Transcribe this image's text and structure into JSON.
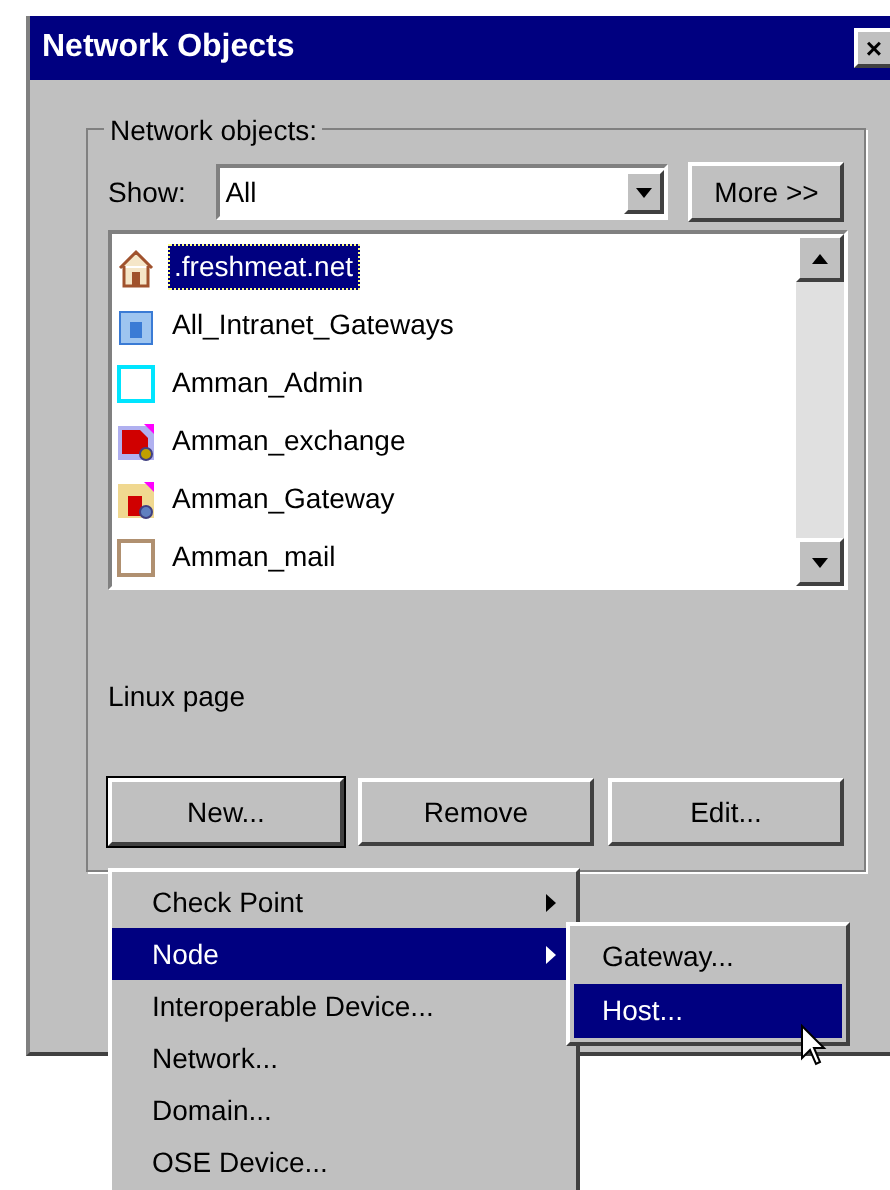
{
  "window": {
    "title": "Network Objects",
    "close": "×"
  },
  "group": {
    "label": "Network objects:"
  },
  "show": {
    "label": "Show:",
    "value": "All",
    "more": "More >>"
  },
  "objects": [
    {
      "name": ".freshmeat.net",
      "kind": "house",
      "selected": true
    },
    {
      "name": "All_Intranet_Gateways",
      "kind": "grid",
      "selected": false
    },
    {
      "name": "Amman_Admin",
      "kind": "frame",
      "selected": false
    },
    {
      "name": "Amman_exchange",
      "kind": "redlock",
      "selected": false
    },
    {
      "name": "Amman_Gateway",
      "kind": "goldlock",
      "selected": false
    },
    {
      "name": "Amman_mail",
      "kind": "plain",
      "selected": false
    }
  ],
  "comment": "Linux page",
  "buttons": [
    {
      "label": "New...",
      "focused": true
    },
    {
      "label": "Remove",
      "focused": false
    },
    {
      "label": "Edit...",
      "focused": false
    }
  ],
  "menu": [
    {
      "label": "Check Point",
      "submenu": true,
      "selected": false
    },
    {
      "label": "Node",
      "submenu": true,
      "selected": true
    },
    {
      "label": "Interoperable Device...",
      "submenu": false,
      "selected": false
    },
    {
      "label": "Network...",
      "submenu": false,
      "selected": false
    },
    {
      "label": "Domain...",
      "submenu": false,
      "selected": false
    },
    {
      "label": "OSE Device...",
      "submenu": false,
      "selected": false
    }
  ],
  "submenu": [
    {
      "label": "Gateway...",
      "selected": false
    },
    {
      "label": "Host...",
      "selected": true
    }
  ]
}
